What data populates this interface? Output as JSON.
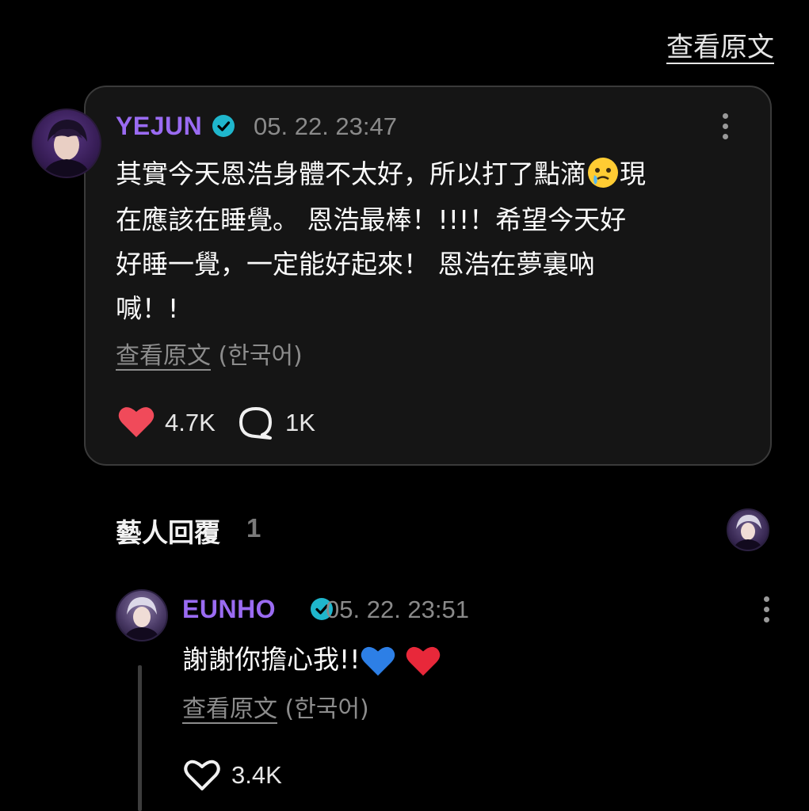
{
  "header": {
    "view_original": "查看原文"
  },
  "post": {
    "author": "YEJUN",
    "timestamp": "05. 22. 23:47",
    "lines": [
      "其實今天恩浩身體不太好，所以打了點滴",
      "現",
      "在應該在睡覺。 恩浩最棒！!!!！希望今天好",
      "好睡一覺，一定能好起來！ 恩浩在夢裏吶",
      "喊！!"
    ],
    "emoji": "face-holding-back-tears",
    "view_original": "查看原文",
    "language": "(한국어)",
    "likes": "4.7K",
    "comments": "1K",
    "colors": {
      "author": "#9a6bf2",
      "verified": "#1fb6cc",
      "heart": "#f04a5a"
    }
  },
  "artist_replies": {
    "title": "藝人回覆",
    "count": "1"
  },
  "reply": {
    "author": "EUNHO",
    "timestamp": "05. 22. 23:51",
    "text": "謝謝你擔心我!!",
    "emojis": [
      "blue-heart",
      "red-heart"
    ],
    "view_original": "查看原文",
    "language": "(한국어)",
    "likes": "3.4K"
  }
}
